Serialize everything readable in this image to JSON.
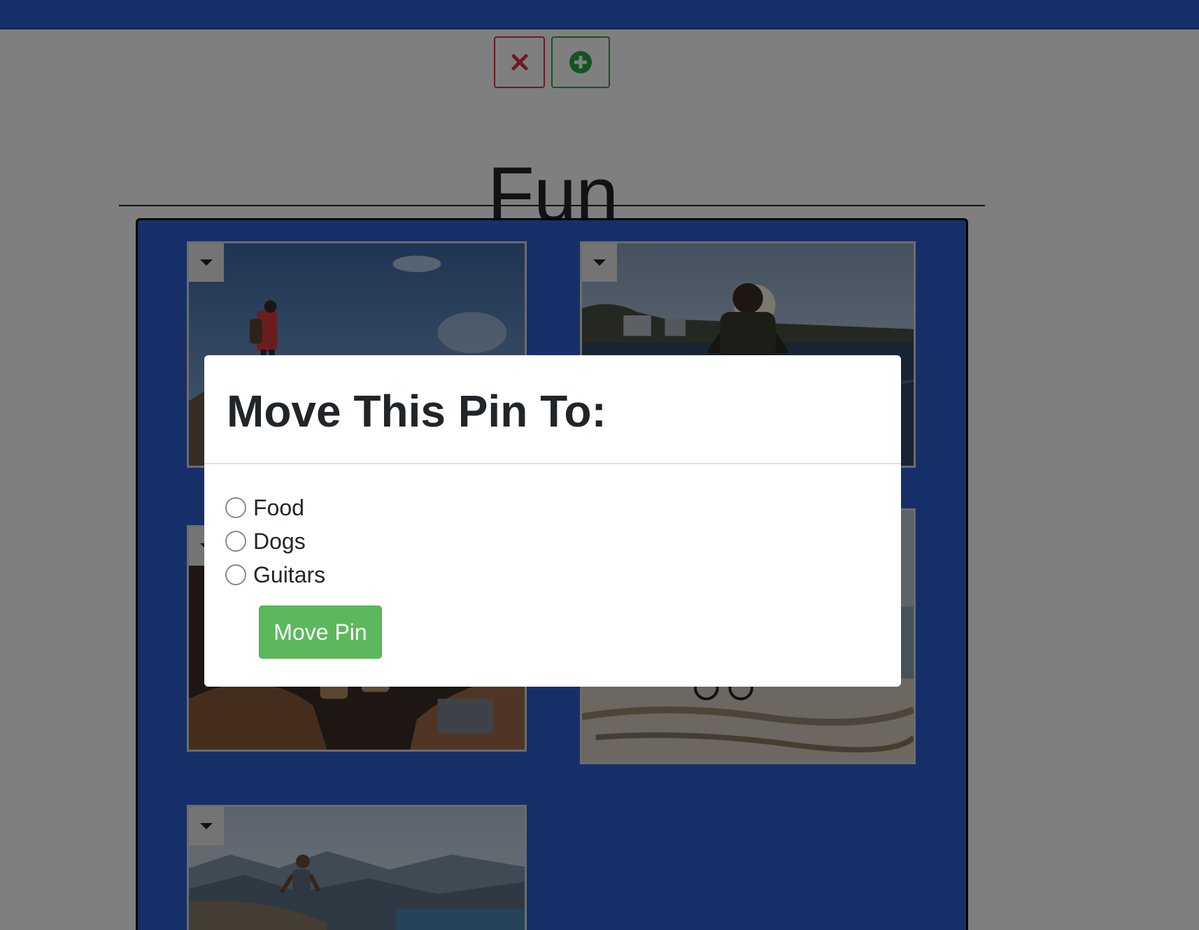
{
  "board": {
    "title": "Fun",
    "delete_icon": "close-icon",
    "add_icon": "plus-circle-icon"
  },
  "colors": {
    "navbar": "#2f5fd1",
    "panel": "#2f5fd1",
    "delete": "#dc3545",
    "add": "#28a745",
    "move_button": "#5cb85c"
  },
  "pins": [
    {
      "menu_icon": "caret-down-icon",
      "scene": "hiker in red jacket on mountain ridge under blue sky"
    },
    {
      "menu_icon": "caret-down-icon",
      "scene": "person with backpack looking at bay and city shoreline"
    },
    {
      "menu_icon": "caret-down-icon",
      "scene": "friends toasting with drinks"
    },
    {
      "menu_icon": "caret-down-icon",
      "scene": "cyclist on rocky coastline"
    },
    {
      "menu_icon": "caret-down-icon",
      "scene": "runner on mountain trail above lake"
    }
  ],
  "modal": {
    "title": "Move This Pin To:",
    "options": [
      {
        "label": "Food",
        "checked": false
      },
      {
        "label": "Dogs",
        "checked": false
      },
      {
        "label": "Guitars",
        "checked": false
      }
    ],
    "submit_label": "Move Pin"
  }
}
